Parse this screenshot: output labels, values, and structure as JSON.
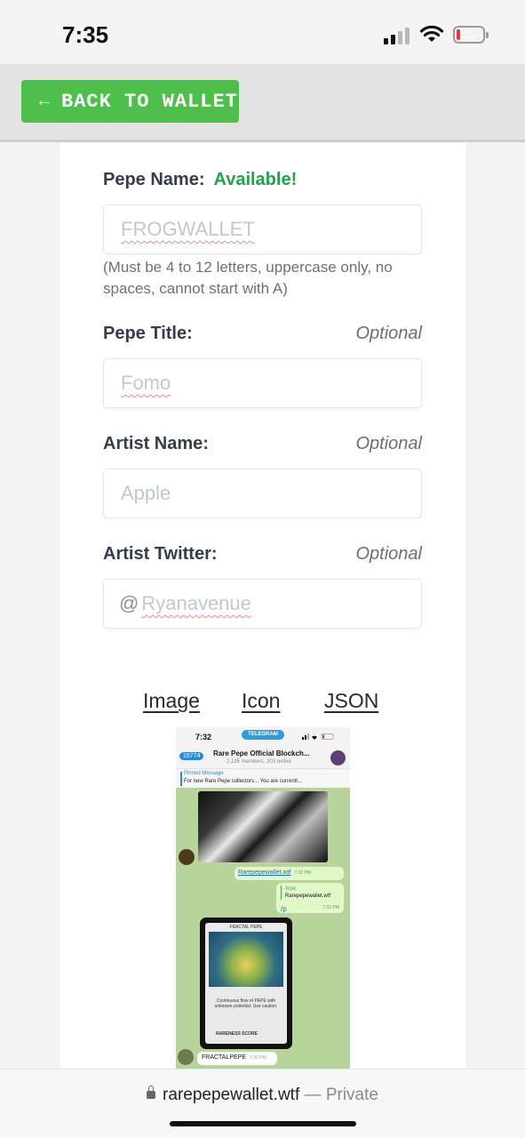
{
  "status_bar": {
    "time": "7:35"
  },
  "topbar": {
    "back_button": "BACK TO WALLET",
    "back_arrow": "←"
  },
  "form": {
    "pepe_name": {
      "label": "Pepe Name:",
      "status": "Available!",
      "placeholder": "FROGWALLET",
      "help": "(Must be 4 to 12 letters, uppercase only, no spaces, cannot start with A)"
    },
    "pepe_title": {
      "label": "Pepe Title:",
      "optional": "Optional",
      "placeholder": "Fomo"
    },
    "artist_name": {
      "label": "Artist Name:",
      "optional": "Optional",
      "placeholder": "Apple"
    },
    "artist_twitter": {
      "label": "Artist Twitter:",
      "optional": "Optional",
      "prefix": "@",
      "placeholder": "Ryanavenue"
    }
  },
  "links": {
    "image": "Image",
    "icon": "Icon",
    "json": "JSON"
  },
  "preview": {
    "time": "7:32",
    "app_pill": "TELEGRAM",
    "back_count": "15774",
    "group_title": "Rare Pepe Official Blockch...",
    "group_sub": "2,135 members, 203 online",
    "pinned_title": "Pinned Message",
    "pinned_msg": "For new Rare Pepe collectors... You are currentl...",
    "msg1_link": "Rarepepewallet.wtf",
    "msg1_time": "7:32 PM",
    "reply_name": "Xcer",
    "reply_text": "Rarepepewallet.wtf",
    "reply_time": "7:32 PM",
    "slash": "/p",
    "card_title": "FRACTAL PEPE",
    "card_desc": "Continuous flow of PEPE with unknown potential. Use caution.",
    "card_score": "RARENESS SCORE",
    "last_msg": "FRACTALPEPE",
    "last_time": "7:32 PM"
  },
  "browser": {
    "url": "rarepepewallet.wtf",
    "separator": " — ",
    "mode": "Private"
  },
  "colors": {
    "accent_green": "#4fbf4b",
    "available_green": "#22a34a",
    "battery_low": "#e5393a"
  }
}
